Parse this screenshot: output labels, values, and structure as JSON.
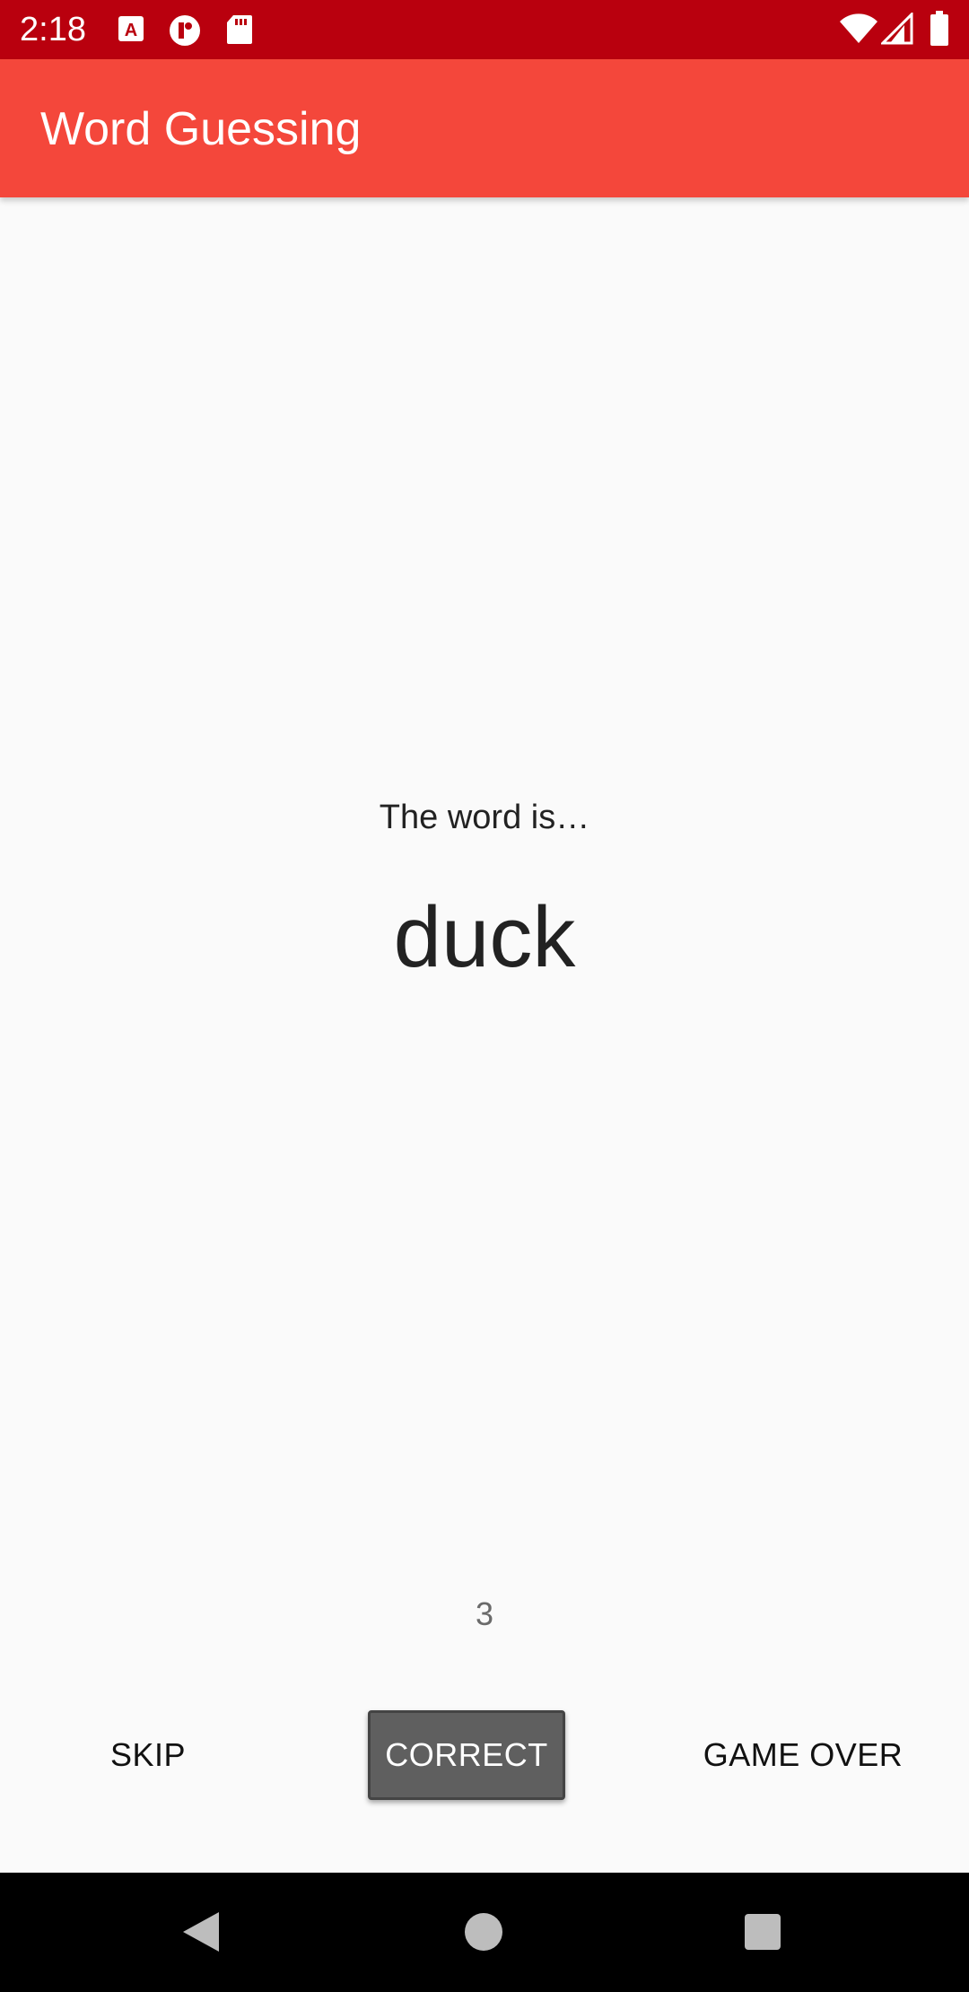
{
  "status_bar": {
    "time": "2:18",
    "icons": [
      "a-notification-icon",
      "circle-p-notification-icon",
      "sd-card-icon",
      "wifi-icon",
      "signal-icon",
      "battery-icon"
    ]
  },
  "app_bar": {
    "title": "Word Guessing",
    "color": "#f4473b"
  },
  "content": {
    "label": "The word is…",
    "word": "duck",
    "score": "3"
  },
  "buttons": {
    "skip": "SKIP",
    "correct": "CORRECT",
    "game_over": "GAME OVER"
  },
  "nav_bar": {
    "icons": [
      "back-icon",
      "home-icon",
      "recents-icon"
    ]
  },
  "colors": {
    "status_bar": "#b9000e",
    "app_bar": "#f4473b",
    "background": "#fafafa",
    "correct_button": "#5f5f5f"
  }
}
